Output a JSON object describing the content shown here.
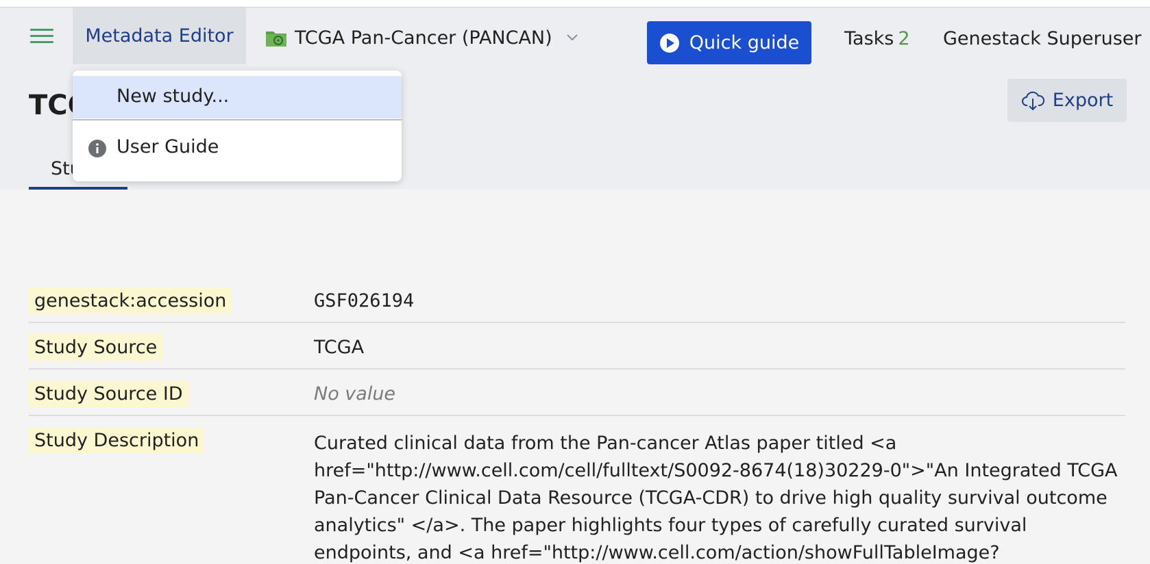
{
  "nav": {
    "app_title": "Metadata Editor",
    "study_selector": "TCGA Pan-Cancer (PANCAN)",
    "quick_guide": "Quick guide",
    "tasks_label": "Tasks",
    "tasks_count": "2",
    "user": "Genestack Superuser"
  },
  "page": {
    "title": "TCGA",
    "tab": "Stu",
    "export": "Export"
  },
  "dropdown": {
    "items": [
      {
        "label": "New study..."
      },
      {
        "label": "User Guide"
      }
    ]
  },
  "metadata": {
    "rows": [
      {
        "key": "genestack:accession",
        "value": "GSF026194"
      },
      {
        "key": "Study Source",
        "value": "TCGA"
      },
      {
        "key": "Study Source ID",
        "value": "No value"
      },
      {
        "key": "Study Description",
        "value": "Curated clinical data from the Pan-cancer Atlas paper titled <a href=\"http://www.cell.com/cell/fulltext/S0092-8674(18)30229-0\">\"An Integrated TCGA Pan-Cancer Clinical Data Resource (TCGA-CDR) to drive high quality survival outcome analytics\" </a>. The paper highlights four types of carefully curated survival endpoints, and <a href=\"http://www.cell.com/action/showFullTableImage?"
      }
    ]
  },
  "colors": {
    "accent": "#1a4fd1",
    "brand_text": "#1f3e8a",
    "menu_icon": "#4a9a6a",
    "task_count": "#4e9a46",
    "key_highlight": "#fbf7d0"
  }
}
